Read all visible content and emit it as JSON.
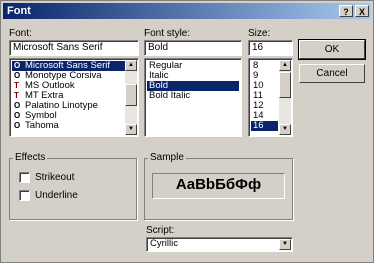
{
  "window": {
    "title": "Font",
    "help_button": "?",
    "close_button": "X"
  },
  "font": {
    "label": "Font:",
    "value": "Microsoft Sans Serif",
    "items": [
      {
        "label": "Microsoft Sans Serif",
        "icon": "opentype-icon",
        "glyph": "O",
        "selected": true
      },
      {
        "label": "Monotype Corsiva",
        "icon": "opentype-icon",
        "glyph": "O"
      },
      {
        "label": "MS Outlook",
        "icon": "truetype-icon",
        "glyph": "T"
      },
      {
        "label": "MT Extra",
        "icon": "truetype-icon",
        "glyph": "T"
      },
      {
        "label": "Palatino Linotype",
        "icon": "opentype-icon",
        "glyph": "O"
      },
      {
        "label": "Symbol",
        "icon": "opentype-icon",
        "glyph": "O"
      },
      {
        "label": "Tahoma",
        "icon": "opentype-icon",
        "glyph": "O"
      }
    ]
  },
  "font_style": {
    "label": "Font style:",
    "value": "Bold",
    "items": [
      {
        "label": "Regular"
      },
      {
        "label": "Italic"
      },
      {
        "label": "Bold",
        "selected": true
      },
      {
        "label": "Bold Italic"
      }
    ]
  },
  "size": {
    "label": "Size:",
    "value": "16",
    "items": [
      {
        "label": "8"
      },
      {
        "label": "9"
      },
      {
        "label": "10"
      },
      {
        "label": "11"
      },
      {
        "label": "12"
      },
      {
        "label": "14"
      },
      {
        "label": "16",
        "selected": true
      }
    ]
  },
  "buttons": {
    "ok": "OK",
    "cancel": "Cancel"
  },
  "effects": {
    "label": "Effects",
    "strikeout": "Strikeout",
    "underline": "Underline",
    "strikeout_checked": false,
    "underline_checked": false
  },
  "sample": {
    "label": "Sample",
    "text": "AaBbБбФф"
  },
  "script": {
    "label": "Script:",
    "value": "Cyrillic"
  },
  "colors": {
    "face": "#d4d0c8",
    "title_start": "#0a246a",
    "title_end": "#a6caf0",
    "selection": "#0a246a"
  }
}
